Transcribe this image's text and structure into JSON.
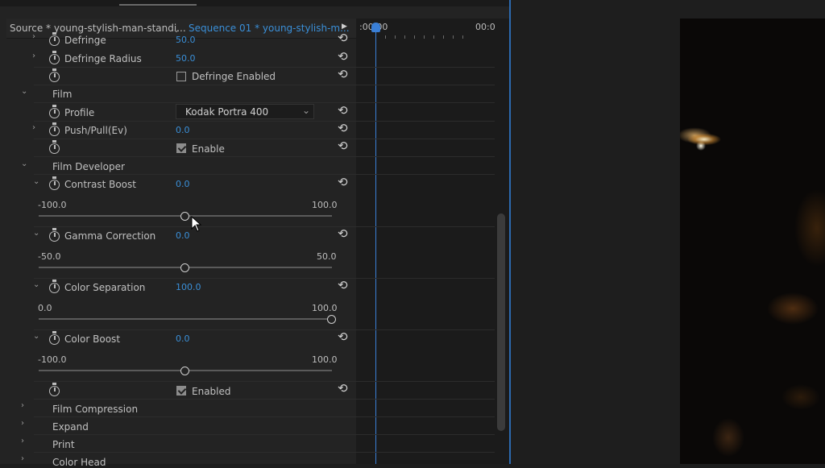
{
  "header": {
    "source_tab": "Source * young-stylish-man-standi...",
    "sequence_tab": "Sequence 01 * young-stylish-m...",
    "timecode_start": ":00:00",
    "timecode_end": "00:0"
  },
  "rows": {
    "defringe": {
      "label": "Defringe",
      "value": "50.0"
    },
    "defringe_radius": {
      "label": "Defringe Radius",
      "value": "50.0"
    },
    "defringe_enabled": {
      "label": "Defringe Enabled",
      "checked": false
    },
    "film": {
      "label": "Film"
    },
    "profile": {
      "label": "Profile",
      "value": "Kodak Portra 400"
    },
    "push_pull": {
      "label": "Push/Pull(Ev)",
      "value": "0.0"
    },
    "film_enable": {
      "label": "Enable",
      "checked": true
    },
    "film_developer": {
      "label": "Film Developer"
    },
    "contrast_boost": {
      "label": "Contrast Boost",
      "value": "0.0",
      "min": "-100.0",
      "max": "100.0",
      "position": 0.5
    },
    "gamma_correction": {
      "label": "Gamma Correction",
      "value": "0.0",
      "min": "-50.0",
      "max": "50.0",
      "position": 0.5
    },
    "color_separation": {
      "label": "Color Separation",
      "value": "100.0",
      "min": "0.0",
      "max": "100.0",
      "position": 1.0
    },
    "color_boost": {
      "label": "Color Boost",
      "value": "0.0",
      "min": "-100.0",
      "max": "100.0",
      "position": 0.5
    },
    "developer_enabled": {
      "label": "Enabled",
      "checked": true
    },
    "film_compression": {
      "label": "Film Compression"
    },
    "expand": {
      "label": "Expand"
    },
    "print": {
      "label": "Print"
    },
    "color_head": {
      "label": "Color Head"
    }
  },
  "icons": {
    "stopwatch": "stopwatch-icon",
    "reset": "reset-icon",
    "chevron": "chevron-icon"
  },
  "glyphs": {
    "chevron_down": "⌄",
    "chevron_right": "›",
    "reset": "⟲",
    "play": "▶",
    "select_caret": "⌄"
  },
  "colors": {
    "accent": "#3a8fd8",
    "panel_bg": "#232323",
    "playhead": "#3a7fd6"
  }
}
